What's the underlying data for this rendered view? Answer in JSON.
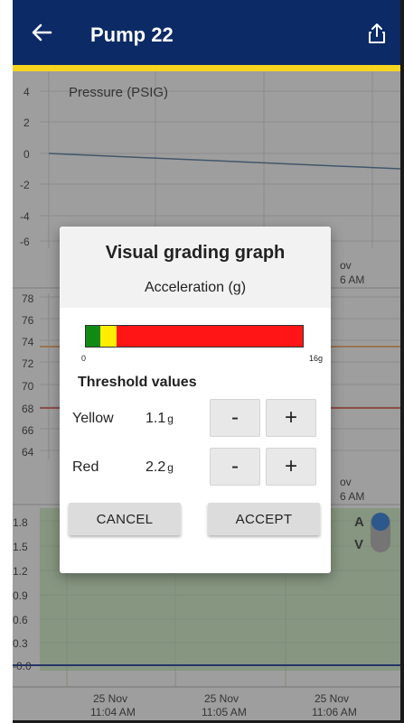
{
  "app_bar": {
    "title": "Pump 22",
    "back_icon": "arrow-left-icon",
    "share_icon": "share-icon",
    "accent_color": "#f7d51f",
    "bg_color": "#0c2a66"
  },
  "charts": {
    "pressure": {
      "title": "Pressure (PSIG)",
      "y_ticks": [
        "4",
        "2",
        "0",
        "-2",
        "-4",
        "-6"
      ],
      "x_label_partial": [
        "ov",
        "6 AM"
      ]
    },
    "temperature": {
      "y_ticks": [
        "78",
        "76",
        "74",
        "72",
        "70",
        "68",
        "66",
        "64"
      ],
      "x_label_partial": [
        "ov",
        "6 AM"
      ]
    },
    "vibration": {
      "y_ticks": [
        "1.8",
        "1.5",
        "1.2",
        "0.9",
        "0.6",
        "0.3",
        "-0.0"
      ],
      "toggle_labels": [
        "A",
        "V"
      ],
      "x_labels": [
        {
          "date": "25 Nov",
          "time": "11:04 AM"
        },
        {
          "date": "25 Nov",
          "time": "11:05 AM"
        },
        {
          "date": "25 Nov",
          "time": "11:06 AM"
        }
      ]
    }
  },
  "dialog": {
    "title": "Visual grading graph",
    "subtitle": "Acceleration (g)",
    "scale_min": "0",
    "scale_max": "16g",
    "thresholds_title": "Threshold values",
    "rows": [
      {
        "label": "Yellow",
        "value": "1.1",
        "unit": "g",
        "minus": "-",
        "plus": "+"
      },
      {
        "label": "Red",
        "value": "2.2",
        "unit": "g",
        "minus": "-",
        "plus": "+"
      }
    ],
    "cancel_label": "CANCEL",
    "accept_label": "ACCEPT",
    "colors": {
      "green": "#118a14",
      "yellow": "#ffee00",
      "red": "#ff1515"
    }
  }
}
